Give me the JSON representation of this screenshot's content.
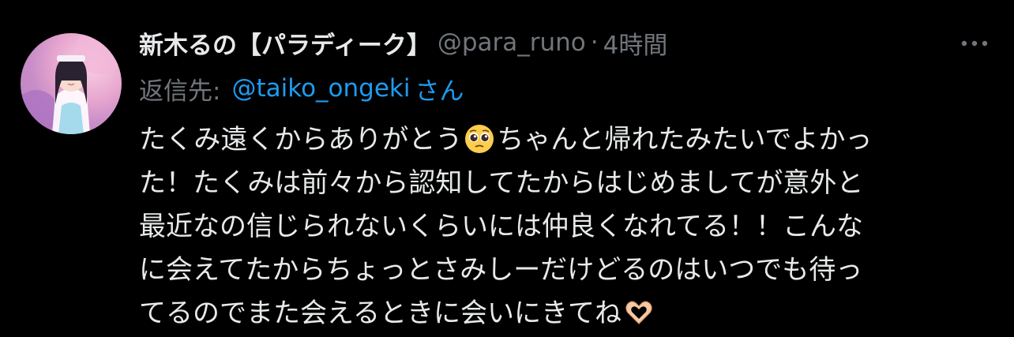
{
  "tweet": {
    "author_name": "新木るの【パラディーク】",
    "author_handle": "@para_runo",
    "separator": "·",
    "timestamp": "4時間",
    "reply_label": "返信先:",
    "reply_to": "@taiko_ongeki",
    "reply_suffix": "さん",
    "lines": {
      "l1a": "たくみ遠くからありがとう",
      "l1b": "ちゃんと帰れたみたいでよかっ",
      "l2": "た！たくみは前々から認知してたからはじめましてが意外と",
      "l3": "最近なの信じられないくらいには仲良くなれてる！！こんな",
      "l4": "に会えてたからちょっとさみしーだけどるのはいつでも待っ",
      "l5": "てるのでまた会えるときに会いにきてね"
    },
    "emojis": [
      "pleading-face-icon",
      "heart-hands-icon"
    ]
  },
  "colors": {
    "background": "#000000",
    "primary_text": "#e7e9ea",
    "secondary_text": "#71767b",
    "link": "#1d9bf0"
  }
}
